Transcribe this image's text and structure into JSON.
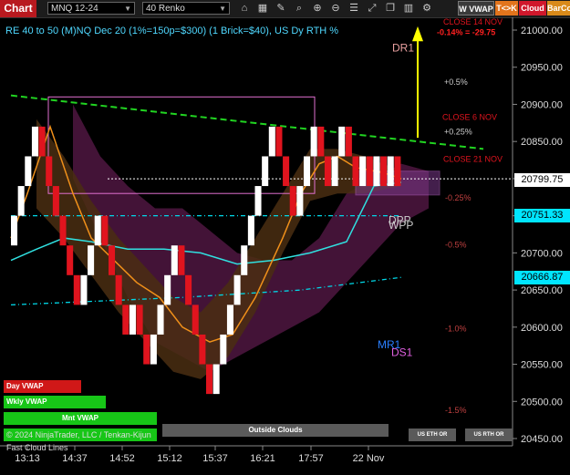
{
  "toolbar": {
    "chart_label": "Chart",
    "symbol": "MNQ 12-24",
    "bar_type": "40 Renko",
    "icons": [
      "tag-icon",
      "chart-icon",
      "pencil-icon",
      "search-icon",
      "zoom-in-icon",
      "zoom-out-icon",
      "list-icon",
      "expand-icon",
      "duplicate-icon",
      "bar-chart-icon",
      "properties-icon"
    ],
    "buttons": {
      "vwap": "W VWAP",
      "tk": "T<>K",
      "cloud": "Cloud",
      "barco": "BarCo"
    }
  },
  "colors": {
    "background": "#000000",
    "up_brick": "#ffffff",
    "down_brick": "#e0141e",
    "accent_red": "#b8191f"
  },
  "chart_data": {
    "type": "renko",
    "title": "RE 40 to 50 (M)NQ Dec 20 (1%=150p=$300) (1 Brick=$40), US Dy RTH %",
    "y_axis": {
      "ylim": [
        20420,
        21030
      ],
      "ticks": [
        21000,
        20950,
        20900,
        20850,
        20800,
        20750,
        20700,
        20650,
        20600,
        20550,
        20500,
        20450
      ],
      "tick_labels": [
        "21000.00",
        "20950.00",
        "20900.00",
        "20850.00",
        "20800.00",
        "20750.00",
        "20700.00",
        "20650.00",
        "20600.00",
        "20550.00",
        "20500.00",
        "20450.00"
      ]
    },
    "x_axis": {
      "tick_labels": [
        "13:13",
        "14:37",
        "14:52",
        "15:12",
        "15:37",
        "16:21",
        "17:57",
        "22 Nov"
      ]
    },
    "bricks": [
      20750,
      20790,
      20830,
      20870,
      20830,
      20790,
      20750,
      20710,
      20670,
      20630,
      20670,
      20710,
      20750,
      20710,
      20670,
      20630,
      20590,
      20630,
      20590,
      20550,
      20590,
      20630,
      20670,
      20710,
      20670,
      20630,
      20590,
      20550,
      20510,
      20550,
      20590,
      20630,
      20670,
      20710,
      20750,
      20790,
      20830,
      20870,
      20830,
      20790,
      20750,
      20790,
      20830,
      20870,
      20830,
      20790,
      20830,
      20870,
      20830,
      20790,
      20830,
      20790,
      20830,
      20790,
      20830,
      20790
    ],
    "current_price": "20799.75",
    "price_tags": [
      "20751.33",
      "20666.87"
    ],
    "level_labels": [
      {
        "text": "CLOSE 14 NOV",
        "value": 21011,
        "color": "#e0141e"
      },
      {
        "text": "-0.14% = -29.75",
        "value": 20997,
        "color": "#ff2020"
      },
      {
        "text": "DR1",
        "value": 20975,
        "color": "#e9a0a0"
      },
      {
        "text": "+0.5%",
        "value": 20930,
        "color": "#cccccc"
      },
      {
        "text": "CLOSE 6 NOV",
        "value": 20883,
        "color": "#e0141e"
      },
      {
        "text": "+0.25%",
        "value": 20863,
        "color": "#cccccc"
      },
      {
        "text": "CLOSE 21 NOV",
        "value": 20826,
        "color": "#e0141e"
      },
      {
        "text": "-0.25%",
        "value": 20774,
        "color": "#c04040"
      },
      {
        "text": "DPP",
        "value": 20743,
        "color": "#cccccc"
      },
      {
        "text": "WPP",
        "value": 20736,
        "color": "#cccccc"
      },
      {
        "text": "-0.5%",
        "value": 20711,
        "color": "#c04040"
      },
      {
        "text": "-1.0%",
        "value": 20598,
        "color": "#c04040"
      },
      {
        "text": "MR1",
        "value": 20575,
        "color": "#2a7fff"
      },
      {
        "text": "DS1",
        "value": 20565,
        "color": "#e060e0"
      },
      {
        "text": "-1.5%",
        "value": 20488,
        "color": "#c04040"
      }
    ],
    "indicator_bars": [
      {
        "label": "Day VWAP",
        "color": "#d01818"
      },
      {
        "label": "Wkly VWAP",
        "color": "#17c617"
      },
      {
        "label": "Mnt VWAP",
        "color": "#17c617"
      },
      {
        "label": "Outside Clouds",
        "color": "#5a5a5a"
      },
      {
        "label": "US ETH OR",
        "color": "#5a5a5a"
      },
      {
        "label": "US RTH OR",
        "color": "#5a5a5a"
      }
    ],
    "footer_overlap": "© 2024 NinjaTrader, LLC / Tenkan-Kijun Fast Cloud Lines"
  }
}
